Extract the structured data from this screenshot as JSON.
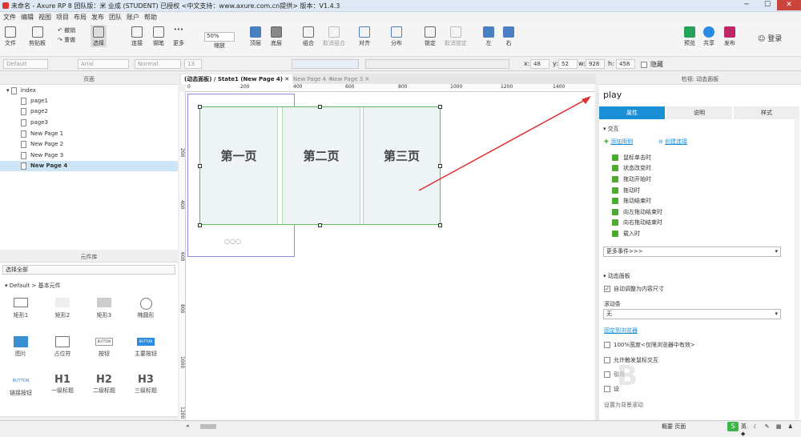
{
  "title": "未命名 - Axure RP 8 团队版：米 业成 (STUDENT) 已授权    <中文支持：www.axure.com.cn提供> 版本：V1.4.3",
  "menu": [
    "文件",
    "编辑",
    "视图",
    "项目",
    "布局",
    "发布",
    "团队",
    "账户",
    "帮助"
  ],
  "toolbar": {
    "file": "文件",
    "clipboard": "剪贴板",
    "undo": "撤销",
    "redo": "重做",
    "select": "选择",
    "connect": "连接",
    "pen": "钢笔",
    "more": "更多",
    "zoom": "50%",
    "zoom_label": "缩放",
    "top": "顶层",
    "bottom": "底层",
    "group": "组合",
    "ungroup": "取消组合",
    "align": "对齐",
    "distribute": "分布",
    "lock": "锁定",
    "unlock": "取消锁定",
    "left": "左",
    "right": "右",
    "preview": "预览",
    "share": "共享",
    "publish": "发布",
    "login": "登录"
  },
  "format": {
    "style": "Default",
    "font": "Arial",
    "weight": "Normal",
    "size": "13",
    "x_label": "x:",
    "x": "48",
    "y_label": "y:",
    "y": "52",
    "w_label": "w:",
    "w": "928",
    "h_label": "h:",
    "h": "458",
    "hidden": "隐藏"
  },
  "pages_panel": {
    "title": "页面",
    "items": [
      "index",
      "page1",
      "page2",
      "page3",
      "New Page 1",
      "New Page 2",
      "New Page 3",
      "New Page 4"
    ]
  },
  "library": {
    "title": "元件库",
    "select": "选择全部",
    "group": "Default > 基本元件",
    "widgets": [
      "矩形1",
      "矩形2",
      "矩形3",
      "椭圆形",
      "图片",
      "占位符",
      "按钮",
      "主要按钮",
      "链接按钮",
      "一级标题",
      "二级标题",
      "三级标题"
    ],
    "button_text": "BUTTON",
    "h1": "H1",
    "h2": "H2",
    "h3": "H3"
  },
  "masters": {
    "title": "母版"
  },
  "tabs": [
    "(动态面板) / State1 (New Page 4)",
    "New Page 4",
    "New Page 3"
  ],
  "ruler_h": [
    "0",
    "200",
    "400",
    "600",
    "800",
    "1000",
    "1200",
    "1400"
  ],
  "ruler_v": [
    "200",
    "400",
    "600",
    "800",
    "1000",
    "1200"
  ],
  "cards": [
    "第一页",
    "第二页",
    "第三页"
  ],
  "dots": "○○○",
  "inspector": {
    "header": "检视: 动态面板",
    "name": "play",
    "tabs": [
      "属性",
      "说明",
      "样式"
    ],
    "interaction": "交互",
    "add_case": "添加用例",
    "create_link": "创建连接",
    "events": [
      "鼠标单击时",
      "状态改变时",
      "拖动开始时",
      "拖动时",
      "拖动结束时",
      "向左拖动结束时",
      "向右拖动结束时",
      "载入时"
    ],
    "more_events": "更多事件>>>",
    "dp_section": "动态面板",
    "auto_fit": "自动调整为内容尺寸",
    "scrollbar": "滚动条",
    "scroll_value": "无",
    "pin": "固定到浏览器",
    "full_width": "100%宽度<仅限浏览器中有效>",
    "allow_bubble": "允许触发鼠标交互",
    "opt1": "引用",
    "opt2": "设",
    "bottom_text": "设置为背景滚动",
    "footer": "概要  页面"
  },
  "colors": {
    "accent": "#1a8fd6",
    "green": "#4caa2f",
    "arrow": "#e03030"
  }
}
